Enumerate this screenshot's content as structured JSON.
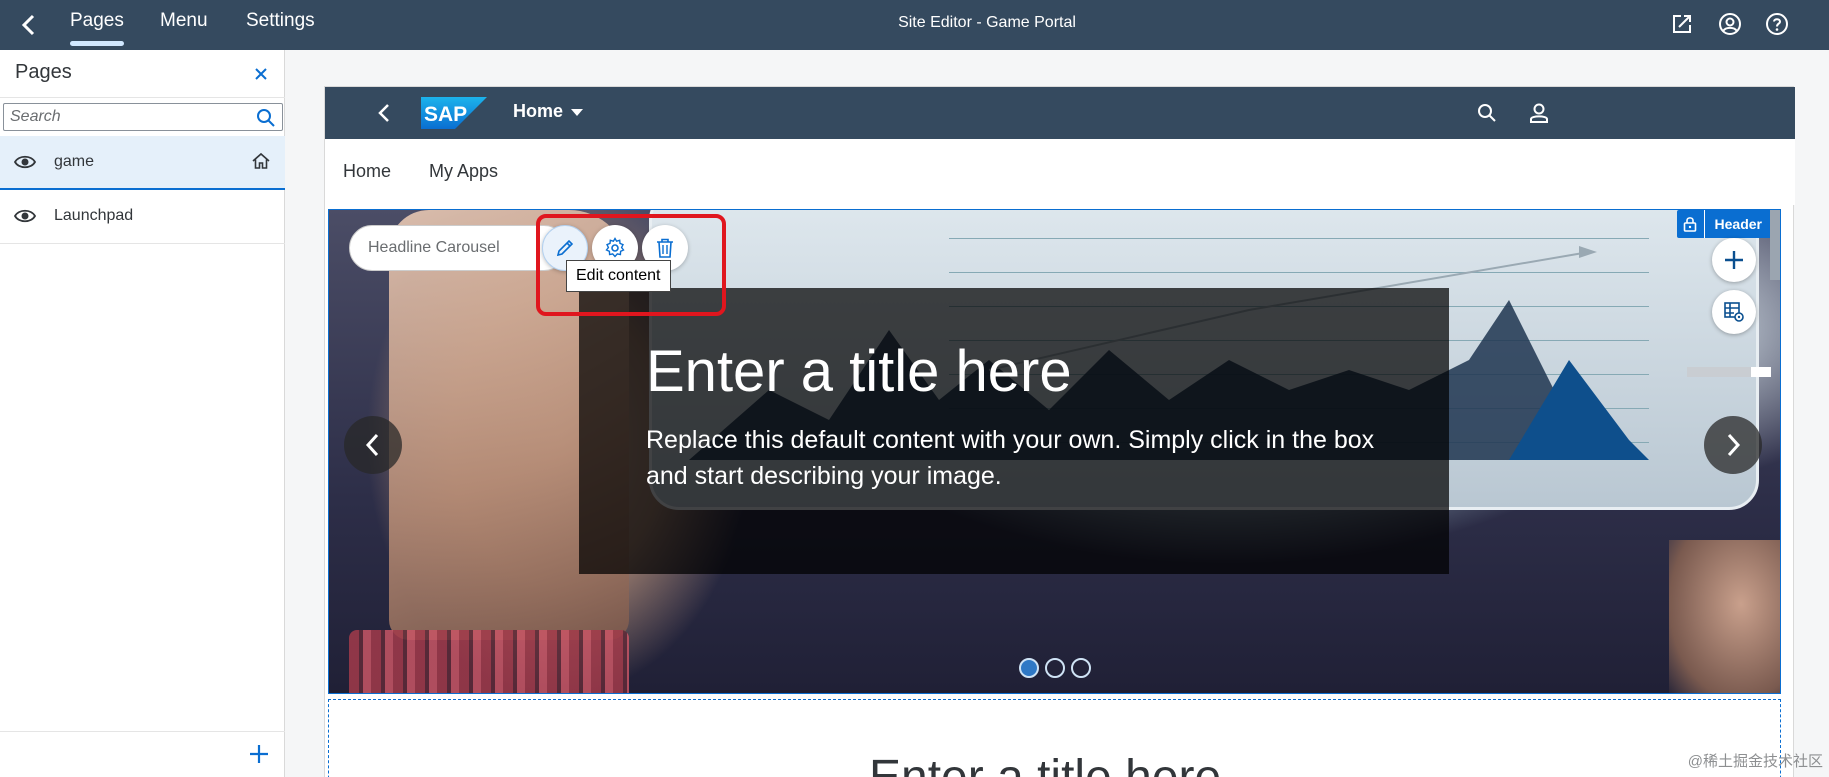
{
  "shell": {
    "tabs": [
      {
        "label": "Pages"
      },
      {
        "label": "Menu"
      },
      {
        "label": "Settings"
      }
    ],
    "title": "Site Editor - Game Portal"
  },
  "pages_panel": {
    "title": "Pages",
    "search_placeholder": "Search",
    "items": [
      {
        "label": "game",
        "selected": true,
        "is_home": true
      },
      {
        "label": "Launchpad",
        "selected": false,
        "is_home": false
      }
    ]
  },
  "site": {
    "logo_text": "SAP",
    "header_title": "Home",
    "menu": [
      {
        "label": "Home"
      },
      {
        "label": "My Apps"
      }
    ],
    "carousel": {
      "widget_name": "Headline Carousel",
      "tooltip": "Edit content",
      "title": "Enter a title here",
      "text": "Replace this default content with your own. Simply click in the box and start describing your image.",
      "section_badge": "Header",
      "slide_count": 3,
      "active_slide": 1
    },
    "section2_title": "Enter a title here"
  },
  "watermark": "@稀土掘金技术社区",
  "colors": {
    "shell": "#354a5f",
    "accent": "#0a6ed1",
    "highlight": "#e0161e"
  }
}
